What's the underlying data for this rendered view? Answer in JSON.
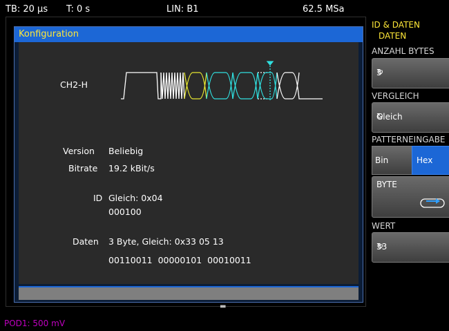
{
  "topbar": {
    "timebase": "TB: 20 µs",
    "trigger_time": "T: 0 s",
    "trigger": "LIN: B1",
    "sample_rate": "62.5 MSa"
  },
  "dialog": {
    "title": "Konfiguration",
    "channel": "CH2-H",
    "version_label": "Version",
    "version_value": "Beliebig",
    "bitrate_label": "Bitrate",
    "bitrate_value": "19.2 kBit/s",
    "id_label": "ID",
    "id_value": "Gleich: 0x04",
    "id_bin": "000100",
    "data_label": "Daten",
    "data_value": "3 Byte, Gleich: 0x33 05 13",
    "data_bin": "00110011  00000101  00010011"
  },
  "softmenu": {
    "title_line1": "ID & DATEN",
    "title_line2": "DATEN",
    "anzahl_label": "ANZAHL BYTES",
    "anzahl_value": "3",
    "vergleich_label": "VERGLEICH",
    "vergleich_value": "Gleich",
    "pattern_label": "PATTERNEINGABE",
    "bin_label": "Bin",
    "hex_label": "Hex",
    "byte_label": "BYTE",
    "wert_label": "WERT",
    "wert_value": "33"
  },
  "status": {
    "pod": "POD1: 500 mV"
  },
  "colors": {
    "accent_blue": "#1c67d6",
    "title_yellow": "#ffe838",
    "pod_magenta": "#c000c0",
    "wave_white": "#ffffff",
    "wave_yellow": "#e8e830",
    "wave_cyan": "#30e0e0"
  }
}
